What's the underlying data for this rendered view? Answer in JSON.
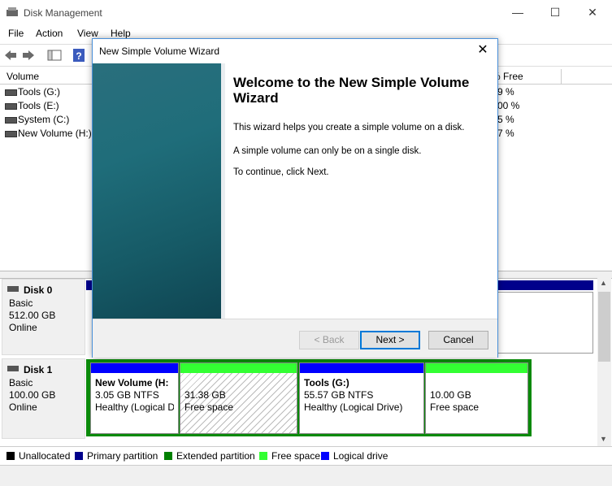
{
  "window": {
    "title": "Disk Management",
    "minimize_icon": "—",
    "maximize_icon": "☐",
    "close_icon": "✕"
  },
  "menu": [
    "File",
    "Action",
    "View",
    "Help"
  ],
  "volume_table": {
    "headers": {
      "volume": "Volume",
      "pct_free": "% Free"
    },
    "rows": [
      {
        "name": "Tools (G:)",
        "pct": "9 %"
      },
      {
        "name": "Tools (E:)",
        "pct": "00 %"
      },
      {
        "name": "System (C:)",
        "pct": "5 %"
      },
      {
        "name": "New Volume (H:)",
        "pct": "7 %"
      }
    ]
  },
  "disks": [
    {
      "name": "Disk 0",
      "type": "Basic",
      "size": "512.00 GB",
      "status": "Online"
    },
    {
      "name": "Disk 1",
      "type": "Basic",
      "size": "100.00 GB",
      "status": "Online"
    }
  ],
  "disk1_partitions": [
    {
      "title": "New Volume  (H:",
      "size": "3.05 GB NTFS",
      "status": "Healthy (Logical D"
    },
    {
      "title": "",
      "size": "31.38 GB",
      "status": "Free space"
    },
    {
      "title": "Tools  (G:)",
      "size": "55.57 GB NTFS",
      "status": "Healthy (Logical Drive)"
    },
    {
      "title": "",
      "size": "10.00 GB",
      "status": "Free space"
    }
  ],
  "legend": [
    {
      "label": "Unallocated",
      "color": "#000000"
    },
    {
      "label": "Primary partition",
      "color": "#00008b"
    },
    {
      "label": "Extended partition",
      "color": "#008000"
    },
    {
      "label": "Free space",
      "color": "#33ff33"
    },
    {
      "label": "Logical drive",
      "color": "#0000ff"
    }
  ],
  "wizard": {
    "title": "New Simple Volume Wizard",
    "close_icon": "✕",
    "heading": "Welcome to the New Simple Volume Wizard",
    "para1": "This wizard helps you create a simple volume on a disk.",
    "para2": "A simple volume can only be on a single disk.",
    "para3": "To continue, click Next.",
    "back_label": "< Back",
    "next_label": "Next >",
    "cancel_label": "Cancel"
  }
}
